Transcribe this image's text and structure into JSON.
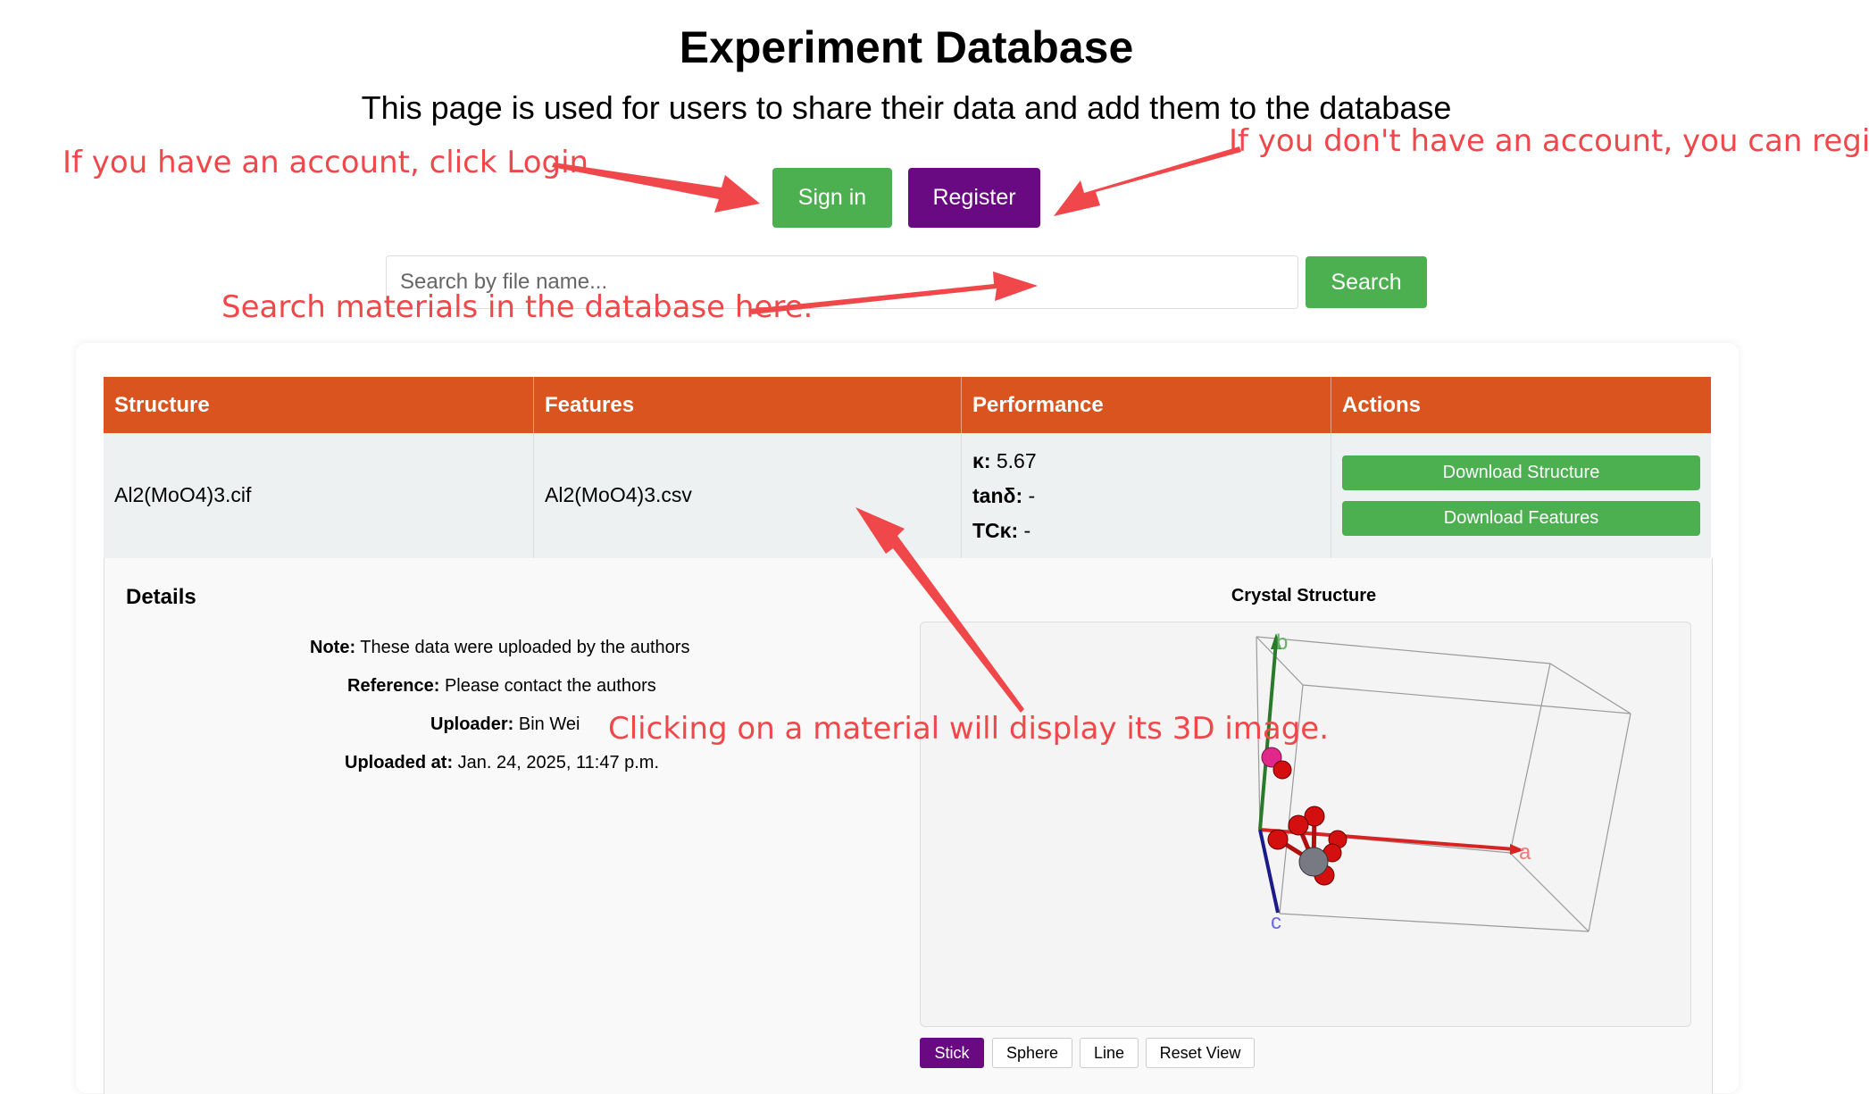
{
  "header": {
    "title": "Experiment Database",
    "subtitle": "This page is used for users to share their data and add them to the database"
  },
  "auth": {
    "signin_label": "Sign in",
    "register_label": "Register"
  },
  "search": {
    "placeholder": "Search by file name...",
    "value": "",
    "button_label": "Search"
  },
  "table": {
    "columns": [
      "Structure",
      "Features",
      "Performance",
      "Actions"
    ],
    "rows": [
      {
        "structure": "Al2(MoO4)3.cif",
        "features": "Al2(MoO4)3.csv",
        "performance": [
          {
            "label": "κ:",
            "value": " 5.67"
          },
          {
            "label": "tanδ:",
            "value": " -"
          },
          {
            "label": "TCκ:",
            "value": " -"
          }
        ],
        "actions": [
          "Download Structure",
          "Download Features"
        ]
      }
    ]
  },
  "details": {
    "title": "Details",
    "fields": [
      {
        "label": "Note:",
        "value": " These data were uploaded by the authors"
      },
      {
        "label": "Reference:",
        "value": " Please contact the authors"
      },
      {
        "label": "Uploader:",
        "value": " Bin Wei"
      },
      {
        "label": "Uploaded at:",
        "value": " Jan. 24, 2025, 11:47 p.m."
      }
    ]
  },
  "viewer": {
    "title": "Crystal Structure",
    "axis_labels": {
      "a": "a",
      "b": "b",
      "c": "c"
    },
    "modes": [
      "Stick",
      "Sphere",
      "Line",
      "Reset View"
    ],
    "active_mode": "Stick"
  },
  "annotations": {
    "login_hint": "If you have an account, click Login.",
    "register_hint": "If you don't have an account, you can register.",
    "search_hint": "Search materials in the database here.",
    "viewer_hint": "Clicking on a material will display its 3D image."
  },
  "colors": {
    "header_bg": "#d9541e",
    "primary_green": "#4caf50",
    "register_purple": "#6a0a83",
    "annotation_red": "#f0474a",
    "row_bg": "#eef1f1"
  }
}
